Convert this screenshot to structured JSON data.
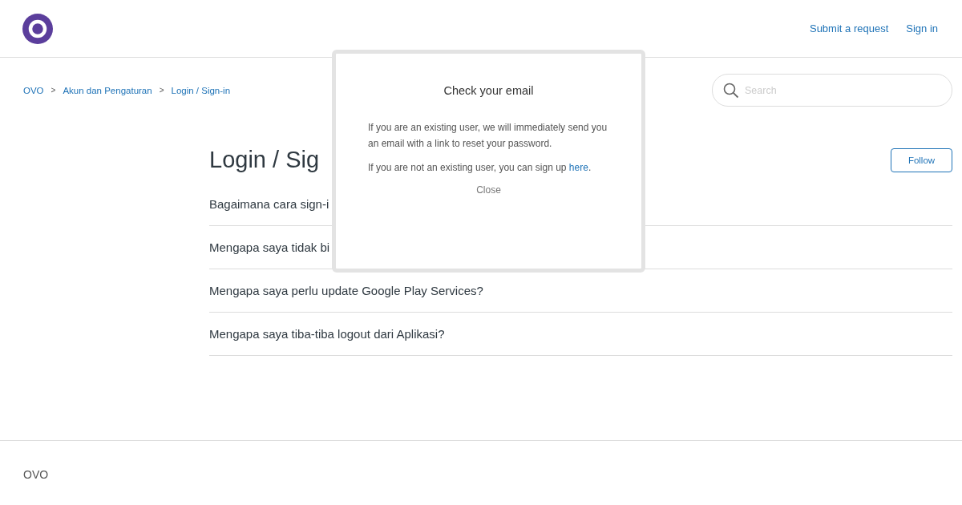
{
  "header": {
    "nav": [
      "Submit a request",
      "Sign in"
    ]
  },
  "breadcrumbs": [
    "OVO",
    "Akun dan Pengaturan",
    "Login / Sign-in"
  ],
  "breadcrumb_separator": ">",
  "search": {
    "placeholder": "Search"
  },
  "section": {
    "title": "Login / Sig",
    "follow_button": "Follow"
  },
  "articles": [
    "Bagaimana cara sign-i",
    "Mengapa saya tidak bi",
    "Mengapa saya perlu update Google Play Services?",
    "Mengapa saya tiba-tiba logout dari Aplikasi?"
  ],
  "dialog": {
    "title": "Check your email",
    "message": "If you are an existing user, we will immediately send you an email with a link to reset your password.",
    "signup_text": "If you are not an existing user, you can sign up",
    "signup_link": "here",
    "signup_after": ".",
    "close": "Close"
  },
  "footer": {
    "brand": "OVO"
  }
}
